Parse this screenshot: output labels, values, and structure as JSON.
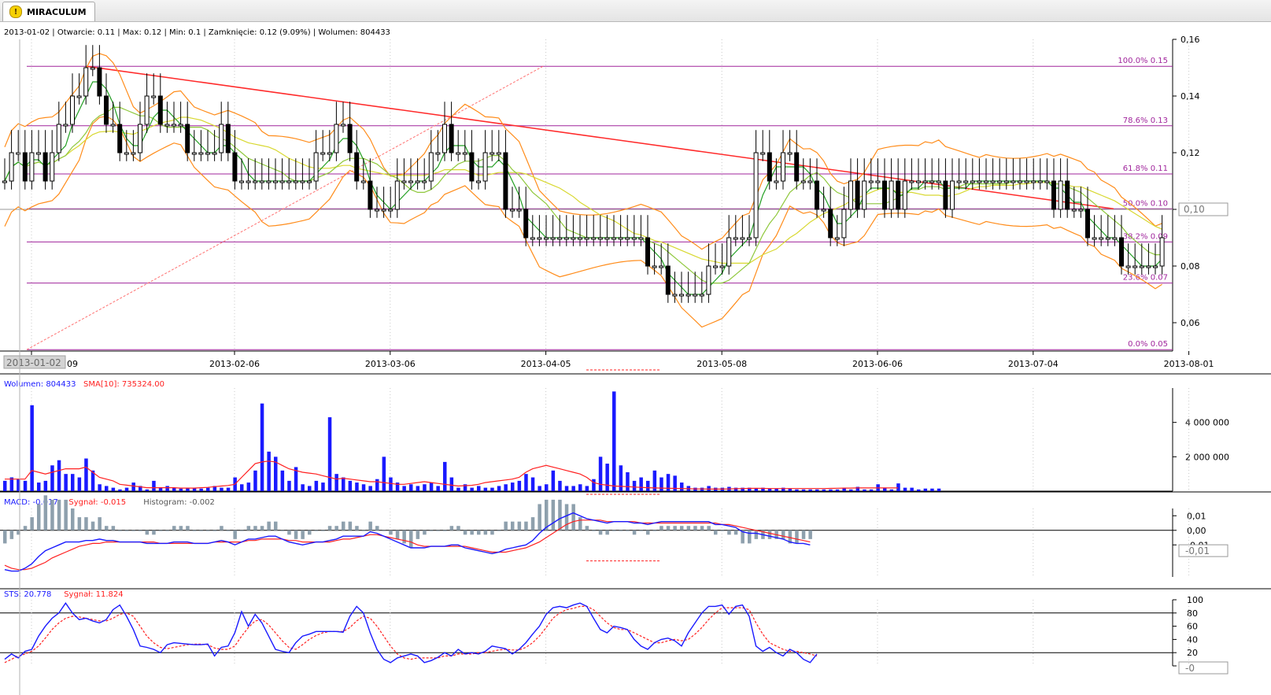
{
  "window": {
    "tab_title": "MIRACULUM",
    "tab_icon": "warning-icon"
  },
  "info_bar": "2013-01-02 | Otwarcie: 0.11 | Max: 0.12 | Min: 0.1 | Zamknięcie: 0.12 (9.09%)  | Wolumen: 804433",
  "colors": {
    "bull": "#ffffff",
    "bear": "#000000",
    "fib": "#a0259c",
    "trend": "#ff2a2a",
    "env": "#ff8c1a",
    "ma_fast": "#23a023",
    "ma_mid": "#8fc83c",
    "ma_slow": "#d8d830",
    "volume": "#1a1aff",
    "signal": "#ff2020",
    "macd": "#1a1aff",
    "hist": "#8ea0ad"
  },
  "chart_data": [
    {
      "type": "candlestick",
      "x_ticks": [
        "2013-01-02",
        "2013-02-06",
        "2013-03-06",
        "2013-04-05",
        "2013-05-08",
        "2013-06-06",
        "2013-07-04",
        "2013-08-01"
      ],
      "x_start_label": "2013-01-02",
      "x_tick_partial": "09",
      "y_ticks": [
        "0,16",
        "0,14",
        "0,12",
        "0,10",
        "0,08",
        "0,06"
      ],
      "ylim": [
        0.05,
        0.16
      ],
      "current_value": "0,10",
      "closes": [
        0.11,
        0.12,
        0.12,
        0.11,
        0.12,
        0.12,
        0.11,
        0.12,
        0.13,
        0.13,
        0.14,
        0.14,
        0.15,
        0.15,
        0.14,
        0.13,
        0.13,
        0.12,
        0.12,
        0.12,
        0.13,
        0.14,
        0.14,
        0.13,
        0.13,
        0.13,
        0.13,
        0.12,
        0.12,
        0.12,
        0.12,
        0.12,
        0.13,
        0.12,
        0.11,
        0.11,
        0.11,
        0.11,
        0.11,
        0.11,
        0.11,
        0.11,
        0.11,
        0.11,
        0.11,
        0.11,
        0.12,
        0.12,
        0.12,
        0.13,
        0.13,
        0.12,
        0.11,
        0.11,
        0.1,
        0.1,
        0.1,
        0.1,
        0.11,
        0.11,
        0.11,
        0.11,
        0.11,
        0.12,
        0.12,
        0.13,
        0.12,
        0.12,
        0.12,
        0.11,
        0.11,
        0.12,
        0.12,
        0.12,
        0.1,
        0.1,
        0.1,
        0.09,
        0.09,
        0.09,
        0.09,
        0.09,
        0.09,
        0.09,
        0.09,
        0.09,
        0.09,
        0.09,
        0.09,
        0.09,
        0.09,
        0.09,
        0.09,
        0.09,
        0.09,
        0.08,
        0.08,
        0.08,
        0.07,
        0.07,
        0.07,
        0.07,
        0.07,
        0.07,
        0.08,
        0.08,
        0.08,
        0.09,
        0.09,
        0.09,
        0.09,
        0.12,
        0.12,
        0.11,
        0.11,
        0.12,
        0.12,
        0.11,
        0.11,
        0.11,
        0.1,
        0.1,
        0.09,
        0.09,
        0.1,
        0.11,
        0.1,
        0.11,
        0.11,
        0.11,
        0.1,
        0.11,
        0.1,
        0.11,
        0.11,
        0.11,
        0.11,
        0.11,
        0.11,
        0.1,
        0.11,
        0.11,
        0.11,
        0.11,
        0.11,
        0.11,
        0.11,
        0.11,
        0.11,
        0.11,
        0.11,
        0.11,
        0.11,
        0.11,
        0.11,
        0.1,
        0.11,
        0.1,
        0.1,
        0.1,
        0.09,
        0.09,
        0.09,
        0.09,
        0.09,
        0.08,
        0.08,
        0.08,
        0.08,
        0.08,
        0.08,
        0.09
      ],
      "fib_levels": [
        {
          "label": "100.0% 0.15",
          "value": 0.1505
        },
        {
          "label": "78.6% 0.13",
          "value": 0.1295
        },
        {
          "label": "61.8% 0.11",
          "value": 0.1125
        },
        {
          "label": "50.0% 0.10",
          "value": 0.1002
        },
        {
          "label": "38.2% 0.09",
          "value": 0.0885
        },
        {
          "label": "23.6% 0.07",
          "value": 0.074
        },
        {
          "label": "0.0% 0.05",
          "value": 0.0505
        }
      ]
    },
    {
      "type": "bar",
      "legend": [
        {
          "text": "Wolumen: 804433",
          "color": "#1a1aff"
        },
        {
          "text": "SMA[10]: 735324.00",
          "color": "#ff2020"
        }
      ],
      "y_ticks": [
        "4 000 000",
        "2 000 000"
      ],
      "ylim": [
        0,
        6000000
      ],
      "values": [
        600000,
        800000,
        700000,
        600000,
        5000000,
        500000,
        600000,
        1500000,
        1800000,
        1000000,
        1000000,
        800000,
        1900000,
        1200000,
        400000,
        300000,
        200000,
        100000,
        200000,
        500000,
        300000,
        100000,
        600000,
        200000,
        300000,
        200000,
        150000,
        200000,
        200000,
        150000,
        200000,
        300000,
        200000,
        200000,
        800000,
        400000,
        500000,
        1200000,
        5100000,
        2300000,
        2000000,
        1200000,
        600000,
        1400000,
        400000,
        300000,
        600000,
        500000,
        4300000,
        1000000,
        800000,
        600000,
        500000,
        400000,
        300000,
        700000,
        2000000,
        800000,
        500000,
        300000,
        400000,
        300000,
        400000,
        500000,
        300000,
        1700000,
        800000,
        200000,
        400000,
        200000,
        300000,
        200000,
        200000,
        300000,
        400000,
        500000,
        600000,
        1000000,
        800000,
        300000,
        400000,
        1200000,
        600000,
        300000,
        300000,
        400000,
        300000,
        700000,
        2000000,
        1600000,
        5800000,
        1500000,
        1100000,
        600000,
        800000,
        600000,
        1200000,
        800000,
        1000000,
        900000,
        500000,
        300000,
        200000,
        200000,
        300000,
        200000,
        200000,
        250000,
        200000,
        200000,
        200000,
        150000,
        200000,
        150000,
        150000,
        200000,
        150000,
        100000,
        100000,
        100000,
        100000,
        100000,
        100000,
        100000,
        200000,
        100000,
        250000,
        100000,
        100000,
        400000,
        200000,
        100000,
        450000,
        200000,
        200000,
        100000,
        150000,
        150000,
        150000
      ],
      "sma": [
        700000,
        700000,
        700000,
        700000,
        1200000,
        1100000,
        1000000,
        1100000,
        1200000,
        1300000,
        1300000,
        1300000,
        1400000,
        1100000,
        800000,
        700000,
        600000,
        400000,
        350000,
        300000,
        250000,
        200000,
        200000,
        200000,
        200000,
        200000,
        180000,
        180000,
        180000,
        200000,
        220000,
        260000,
        300000,
        330000,
        400000,
        800000,
        1200000,
        1600000,
        1700000,
        1750000,
        1700000,
        1500000,
        1300000,
        1200000,
        1100000,
        1050000,
        1000000,
        900000,
        800000,
        700000,
        750000,
        700000,
        650000,
        600000,
        550000,
        550000,
        500000,
        450000,
        400000,
        400000,
        450000,
        500000,
        550000,
        500000,
        450000,
        400000,
        350000,
        300000,
        320000,
        340000,
        400000,
        500000,
        550000,
        600000,
        650000,
        700000,
        800000,
        1100000,
        1300000,
        1400000,
        1500000,
        1400000,
        1300000,
        1200000,
        1100000,
        1000000,
        800000,
        500000,
        400000,
        350000,
        300000,
        280000,
        260000,
        240000,
        220000,
        200000,
        190000,
        180000,
        170000,
        160000,
        150000,
        140000,
        130000,
        130000,
        120000,
        120000,
        120000,
        130000,
        140000,
        150000,
        160000,
        170000,
        160000,
        150000,
        150000,
        150000,
        150000,
        150000,
        150000,
        150000,
        150000,
        150000,
        160000,
        170000,
        180000,
        180000,
        190000,
        190000,
        190000,
        190000,
        190000,
        190000,
        190000
      ]
    },
    {
      "type": "line",
      "legend": [
        {
          "text": "MACD: -0.017",
          "color": "#1a1aff"
        },
        {
          "text": "Sygnał: -0.015",
          "color": "#ff2020"
        },
        {
          "text": "Histogram: -0.002",
          "color": "#555555"
        }
      ],
      "y_ticks": [
        "0,01",
        "0,00",
        "-0,01"
      ],
      "ylim": [
        -0.032,
        0.015
      ],
      "current_value": "-0,01",
      "macd": [
        -0.027,
        -0.028,
        -0.028,
        -0.026,
        -0.023,
        -0.018,
        -0.014,
        -0.012,
        -0.01,
        -0.008,
        -0.008,
        -0.008,
        -0.007,
        -0.007,
        -0.006,
        -0.007,
        -0.007,
        -0.008,
        -0.008,
        -0.008,
        -0.008,
        -0.009,
        -0.009,
        -0.009,
        -0.009,
        -0.008,
        -0.008,
        -0.008,
        -0.009,
        -0.009,
        -0.009,
        -0.008,
        -0.007,
        -0.008,
        -0.01,
        -0.008,
        -0.006,
        -0.006,
        -0.005,
        -0.004,
        -0.004,
        -0.006,
        -0.008,
        -0.009,
        -0.01,
        -0.009,
        -0.008,
        -0.008,
        -0.007,
        -0.006,
        -0.004,
        -0.004,
        -0.004,
        -0.004,
        -0.001,
        -0.002,
        -0.004,
        -0.006,
        -0.008,
        -0.01,
        -0.012,
        -0.012,
        -0.012,
        -0.011,
        -0.011,
        -0.011,
        -0.01,
        -0.01,
        -0.012,
        -0.013,
        -0.014,
        -0.015,
        -0.016,
        -0.015,
        -0.013,
        -0.012,
        -0.011,
        -0.01,
        -0.007,
        -0.002,
        0.002,
        0.005,
        0.008,
        0.01,
        0.012,
        0.01,
        0.008,
        0.007,
        0.006,
        0.005,
        0.006,
        0.006,
        0.006,
        0.005,
        0.005,
        0.004,
        0.005,
        0.006,
        0.006,
        0.006,
        0.006,
        0.006,
        0.006,
        0.006,
        0.006,
        0.004,
        0.004,
        0.003,
        0.002,
        -0.001,
        -0.002,
        -0.002,
        -0.003,
        -0.004,
        -0.005,
        -0.006,
        -0.008,
        -0.009,
        -0.009,
        -0.01
      ],
      "signal": [
        -0.024,
        -0.026,
        -0.027,
        -0.027,
        -0.026,
        -0.024,
        -0.022,
        -0.019,
        -0.017,
        -0.015,
        -0.013,
        -0.011,
        -0.01,
        -0.009,
        -0.009,
        -0.008,
        -0.008,
        -0.008,
        -0.008,
        -0.008,
        -0.008,
        -0.008,
        -0.008,
        -0.009,
        -0.009,
        -0.009,
        -0.009,
        -0.009,
        -0.009,
        -0.009,
        -0.009,
        -0.008,
        -0.008,
        -0.008,
        -0.008,
        -0.008,
        -0.007,
        -0.007,
        -0.006,
        -0.006,
        -0.006,
        -0.006,
        -0.007,
        -0.007,
        -0.008,
        -0.008,
        -0.008,
        -0.008,
        -0.008,
        -0.007,
        -0.006,
        -0.006,
        -0.005,
        -0.004,
        -0.003,
        -0.003,
        -0.004,
        -0.005,
        -0.006,
        -0.007,
        -0.008,
        -0.01,
        -0.011,
        -0.011,
        -0.011,
        -0.011,
        -0.011,
        -0.011,
        -0.011,
        -0.012,
        -0.013,
        -0.014,
        -0.015,
        -0.015,
        -0.015,
        -0.014,
        -0.013,
        -0.012,
        -0.01,
        -0.008,
        -0.005,
        -0.002,
        0.001,
        0.004,
        0.006,
        0.007,
        0.007,
        0.007,
        0.007,
        0.006,
        0.006,
        0.006,
        0.006,
        0.006,
        0.005,
        0.005,
        0.005,
        0.005,
        0.005,
        0.005,
        0.005,
        0.005,
        0.005,
        0.005,
        0.005,
        0.005,
        0.004,
        0.004,
        0.003,
        0.002,
        0.001,
        0.0,
        -0.001,
        -0.002,
        -0.003,
        -0.004,
        -0.005,
        -0.006,
        -0.007,
        -0.008
      ]
    },
    {
      "type": "line",
      "legend": [
        {
          "text": "STS: 20.778",
          "color": "#1a1aff"
        },
        {
          "text": "Sygnał: 11.824",
          "color": "#ff2020"
        }
      ],
      "y_ticks": [
        "100",
        "80",
        "60",
        "40",
        "20",
        "0"
      ],
      "ylim": [
        0,
        100
      ],
      "current_value": "-0",
      "sts": [
        10,
        18,
        12,
        22,
        25,
        45,
        60,
        72,
        80,
        95,
        80,
        70,
        72,
        68,
        65,
        70,
        85,
        92,
        75,
        55,
        30,
        28,
        25,
        20,
        32,
        35,
        34,
        33,
        32,
        32,
        33,
        15,
        28,
        30,
        50,
        82,
        60,
        78,
        65,
        45,
        25,
        22,
        20,
        35,
        45,
        48,
        52,
        52,
        52,
        52,
        51,
        75,
        90,
        80,
        50,
        25,
        10,
        5,
        12,
        15,
        18,
        15,
        5,
        8,
        13,
        20,
        15,
        25,
        18,
        20,
        18,
        22,
        30,
        28,
        26,
        18,
        25,
        35,
        48,
        60,
        78,
        88,
        90,
        88,
        92,
        95,
        90,
        72,
        55,
        50,
        60,
        58,
        55,
        40,
        30,
        25,
        35,
        40,
        42,
        38,
        30,
        50,
        65,
        80,
        90,
        90,
        92,
        78,
        90,
        92,
        75,
        30,
        22,
        28,
        20,
        15,
        25,
        20,
        10,
        5,
        18
      ],
      "sts_signal": [
        5,
        10,
        15,
        18,
        22,
        30,
        42,
        55,
        65,
        72,
        75,
        74,
        72,
        70,
        68,
        68,
        72,
        78,
        80,
        75,
        60,
        45,
        35,
        28,
        26,
        28,
        30,
        32,
        33,
        33,
        32,
        27,
        25,
        25,
        30,
        45,
        58,
        68,
        70,
        62,
        50,
        38,
        28,
        25,
        32,
        40,
        46,
        50,
        52,
        52,
        52,
        58,
        68,
        75,
        72,
        60,
        45,
        30,
        18,
        12,
        10,
        12,
        12,
        12,
        12,
        15,
        15,
        18,
        18,
        18,
        20,
        20,
        22,
        24,
        25,
        24,
        24,
        28,
        35,
        45,
        58,
        72,
        80,
        85,
        87,
        90,
        90,
        85,
        75,
        65,
        58,
        55,
        55,
        50,
        45,
        40,
        35,
        35,
        38,
        40,
        38,
        40,
        48,
        58,
        70,
        80,
        88,
        88,
        88,
        88,
        85,
        65,
        48,
        35,
        30,
        25,
        22,
        22,
        20,
        18,
        15
      ]
    }
  ]
}
